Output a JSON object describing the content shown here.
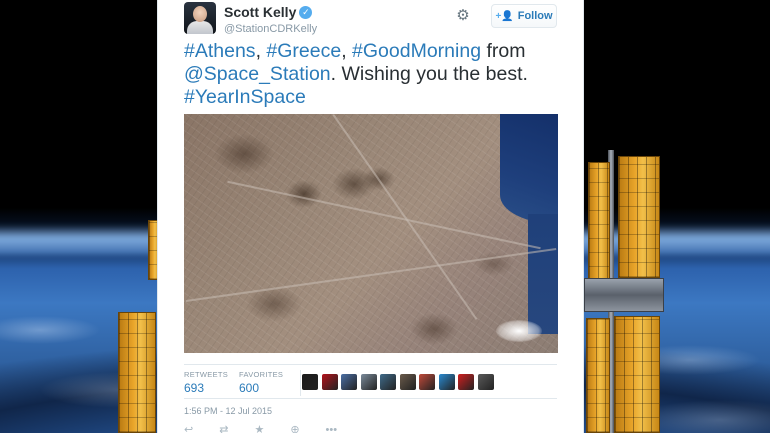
{
  "tweet": {
    "author_name": "Scott Kelly",
    "author_handle": "@StationCDRKelly",
    "follow_label": "Follow",
    "text_parts": [
      {
        "text": "#Athens",
        "link": true
      },
      {
        "text": ", ",
        "link": false
      },
      {
        "text": "#Greece",
        "link": true
      },
      {
        "text": ", ",
        "link": false
      },
      {
        "text": "#GoodMorning",
        "link": true
      },
      {
        "text": " from ",
        "link": false
      },
      {
        "text": "@Space_Station",
        "link": true
      },
      {
        "text": ". Wishing you the best. ",
        "link": false
      },
      {
        "text": "#YearInSpace",
        "link": true
      }
    ],
    "stats": {
      "retweets_label": "RETWEETS",
      "retweets_value": "693",
      "favorites_label": "FAVORITES",
      "favorites_value": "600"
    },
    "timestamp": "1:56 PM - 12 Jul 2015"
  },
  "favoriter_avatars": [
    {
      "color": "#1a1a1a"
    },
    {
      "color": "#b3121b"
    },
    {
      "color": "#4a6fa5"
    },
    {
      "color": "#7a8a9a"
    },
    {
      "color": "#3f6b8a"
    },
    {
      "color": "#6a5a4a"
    },
    {
      "color": "#c04a3a"
    },
    {
      "color": "#2a8ad0"
    },
    {
      "color": "#d02020"
    },
    {
      "color": "#5a5a5a"
    }
  ],
  "icons": {
    "verified": "verified-badge-icon",
    "gear": "gear-icon",
    "follow": "follow-person-icon",
    "actions": [
      "reply-icon",
      "retweet-icon",
      "favorite-icon",
      "bookmark-icon",
      "more-icon"
    ]
  },
  "colors": {
    "link": "#2b7bb9",
    "text": "#292f33",
    "muted": "#8899a6"
  }
}
